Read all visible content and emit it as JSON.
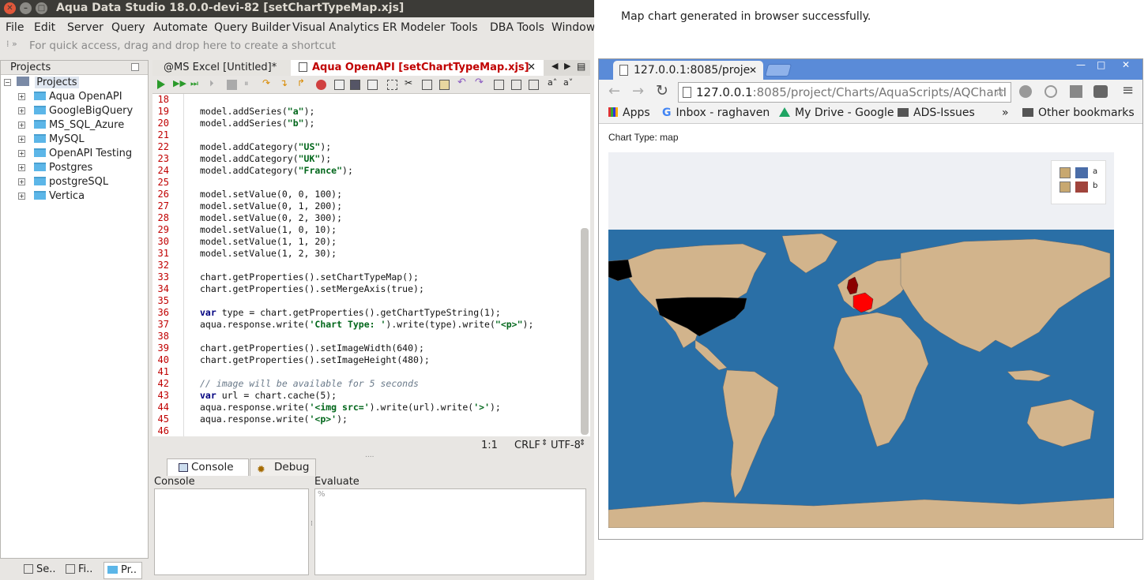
{
  "ide": {
    "title": "Aqua Data Studio 18.0.0-devi-82 [setChartTypeMap.xjs]",
    "menu": [
      "File",
      "Edit",
      "Server",
      "Query",
      "Automate",
      "Query Builder",
      "Visual Analytics",
      "ER Modeler",
      "Tools",
      "DBA Tools",
      "Window"
    ],
    "quick_access": "For quick access, drag and drop here to create a shortcut",
    "projects_header": "Projects",
    "tree_root": "Projects",
    "projects": [
      "Aqua OpenAPI",
      "GoogleBigQuery",
      "MS_SQL_Azure",
      "MySQL",
      "OpenAPI Testing",
      "Postgres",
      "postgreSQL",
      "Vertica"
    ],
    "bottom_tabs": [
      "Se..",
      "Fi..",
      "Pr.."
    ],
    "editor_tabs": [
      "@MS Excel [Untitled]*",
      "Aqua OpenAPI [setChartTypeMap.xjs]"
    ],
    "line_numbers": [
      "18",
      "19",
      "20",
      "21",
      "22",
      "23",
      "24",
      "25",
      "26",
      "27",
      "28",
      "29",
      "30",
      "31",
      "32",
      "33",
      "34",
      "35",
      "36",
      "37",
      "38",
      "39",
      "40",
      "41",
      "42",
      "43",
      "44",
      "45",
      "46"
    ],
    "status": {
      "position": "1:1",
      "line_ending": "CRLF",
      "encoding": "UTF-8"
    },
    "console_tabs": [
      "Console",
      "Debug"
    ],
    "console_label": "Console",
    "evaluate_label": "Evaluate",
    "evaluate_prompt": "%"
  },
  "code": {
    "l19a": "model.addSeries(",
    "l19s": "\"a\"",
    "l19b": ");",
    "l20a": "model.addSeries(",
    "l20s": "\"b\"",
    "l20b": ");",
    "l22a": "model.addCategory(",
    "l22s": "\"US\"",
    "l22b": ");",
    "l23a": "model.addCategory(",
    "l23s": "\"UK\"",
    "l23b": ");",
    "l24a": "model.addCategory(",
    "l24s": "\"France\"",
    "l24b": ");",
    "l26": "model.setValue(0, 0, 100);",
    "l27": "model.setValue(0, 1, 200);",
    "l28": "model.setValue(0, 2, 300);",
    "l29": "model.setValue(1, 0, 10);",
    "l30": "model.setValue(1, 1, 20);",
    "l31": "model.setValue(1, 2, 30);",
    "l33": "chart.getProperties().setChartTypeMap();",
    "l34": "chart.getProperties().setMergeAxis(true);",
    "l36k": "var",
    "l36": " type = chart.getProperties().getChartTypeString(1);",
    "l37a": "aqua.response.write(",
    "l37s": "'Chart Type: '",
    "l37b": ").write(type).write(",
    "l37s2": "\"<p>\"",
    "l37c": ");",
    "l39": "chart.getProperties().setImageWidth(640);",
    "l40": "chart.getProperties().setImageHeight(480);",
    "l42": "// image will be available for 5 seconds",
    "l43k": "var",
    "l43": " url = chart.cache(5);",
    "l44a": "aqua.response.write(",
    "l44s": "'<img src='",
    "l44b": ").write(url).write(",
    "l44s2": "'>'",
    "l44c": ");",
    "l45a": "aqua.response.write(",
    "l45s": "'<p>'",
    "l45b": ");"
  },
  "message": "Map chart generated in browser successfully.",
  "browser": {
    "tab_title": "127.0.0.1:8085/proje",
    "url_host": "127.0.0.1",
    "url_rest": ":8085/project/Charts/AquaScripts/AQChartI",
    "bookmarks": [
      "Apps",
      "Inbox - raghaven",
      "My Drive - Google",
      "ADS-Issues",
      "Other bookmarks"
    ],
    "page_text": "Chart Type: map"
  },
  "chart_data": {
    "type": "map",
    "series": [
      {
        "name": "a",
        "color": "#4a6da8",
        "values": [
          100,
          200,
          300
        ]
      },
      {
        "name": "b",
        "color": "#a0443c",
        "values": [
          10,
          20,
          30
        ]
      }
    ],
    "categories": [
      "US",
      "UK",
      "France"
    ],
    "legend_position": "top-right",
    "colors": {
      "ocean": "#2a6fa6",
      "land": "#d2b48c",
      "us": "#000000",
      "uk": "#8b0000",
      "france": "#ff0000"
    }
  }
}
